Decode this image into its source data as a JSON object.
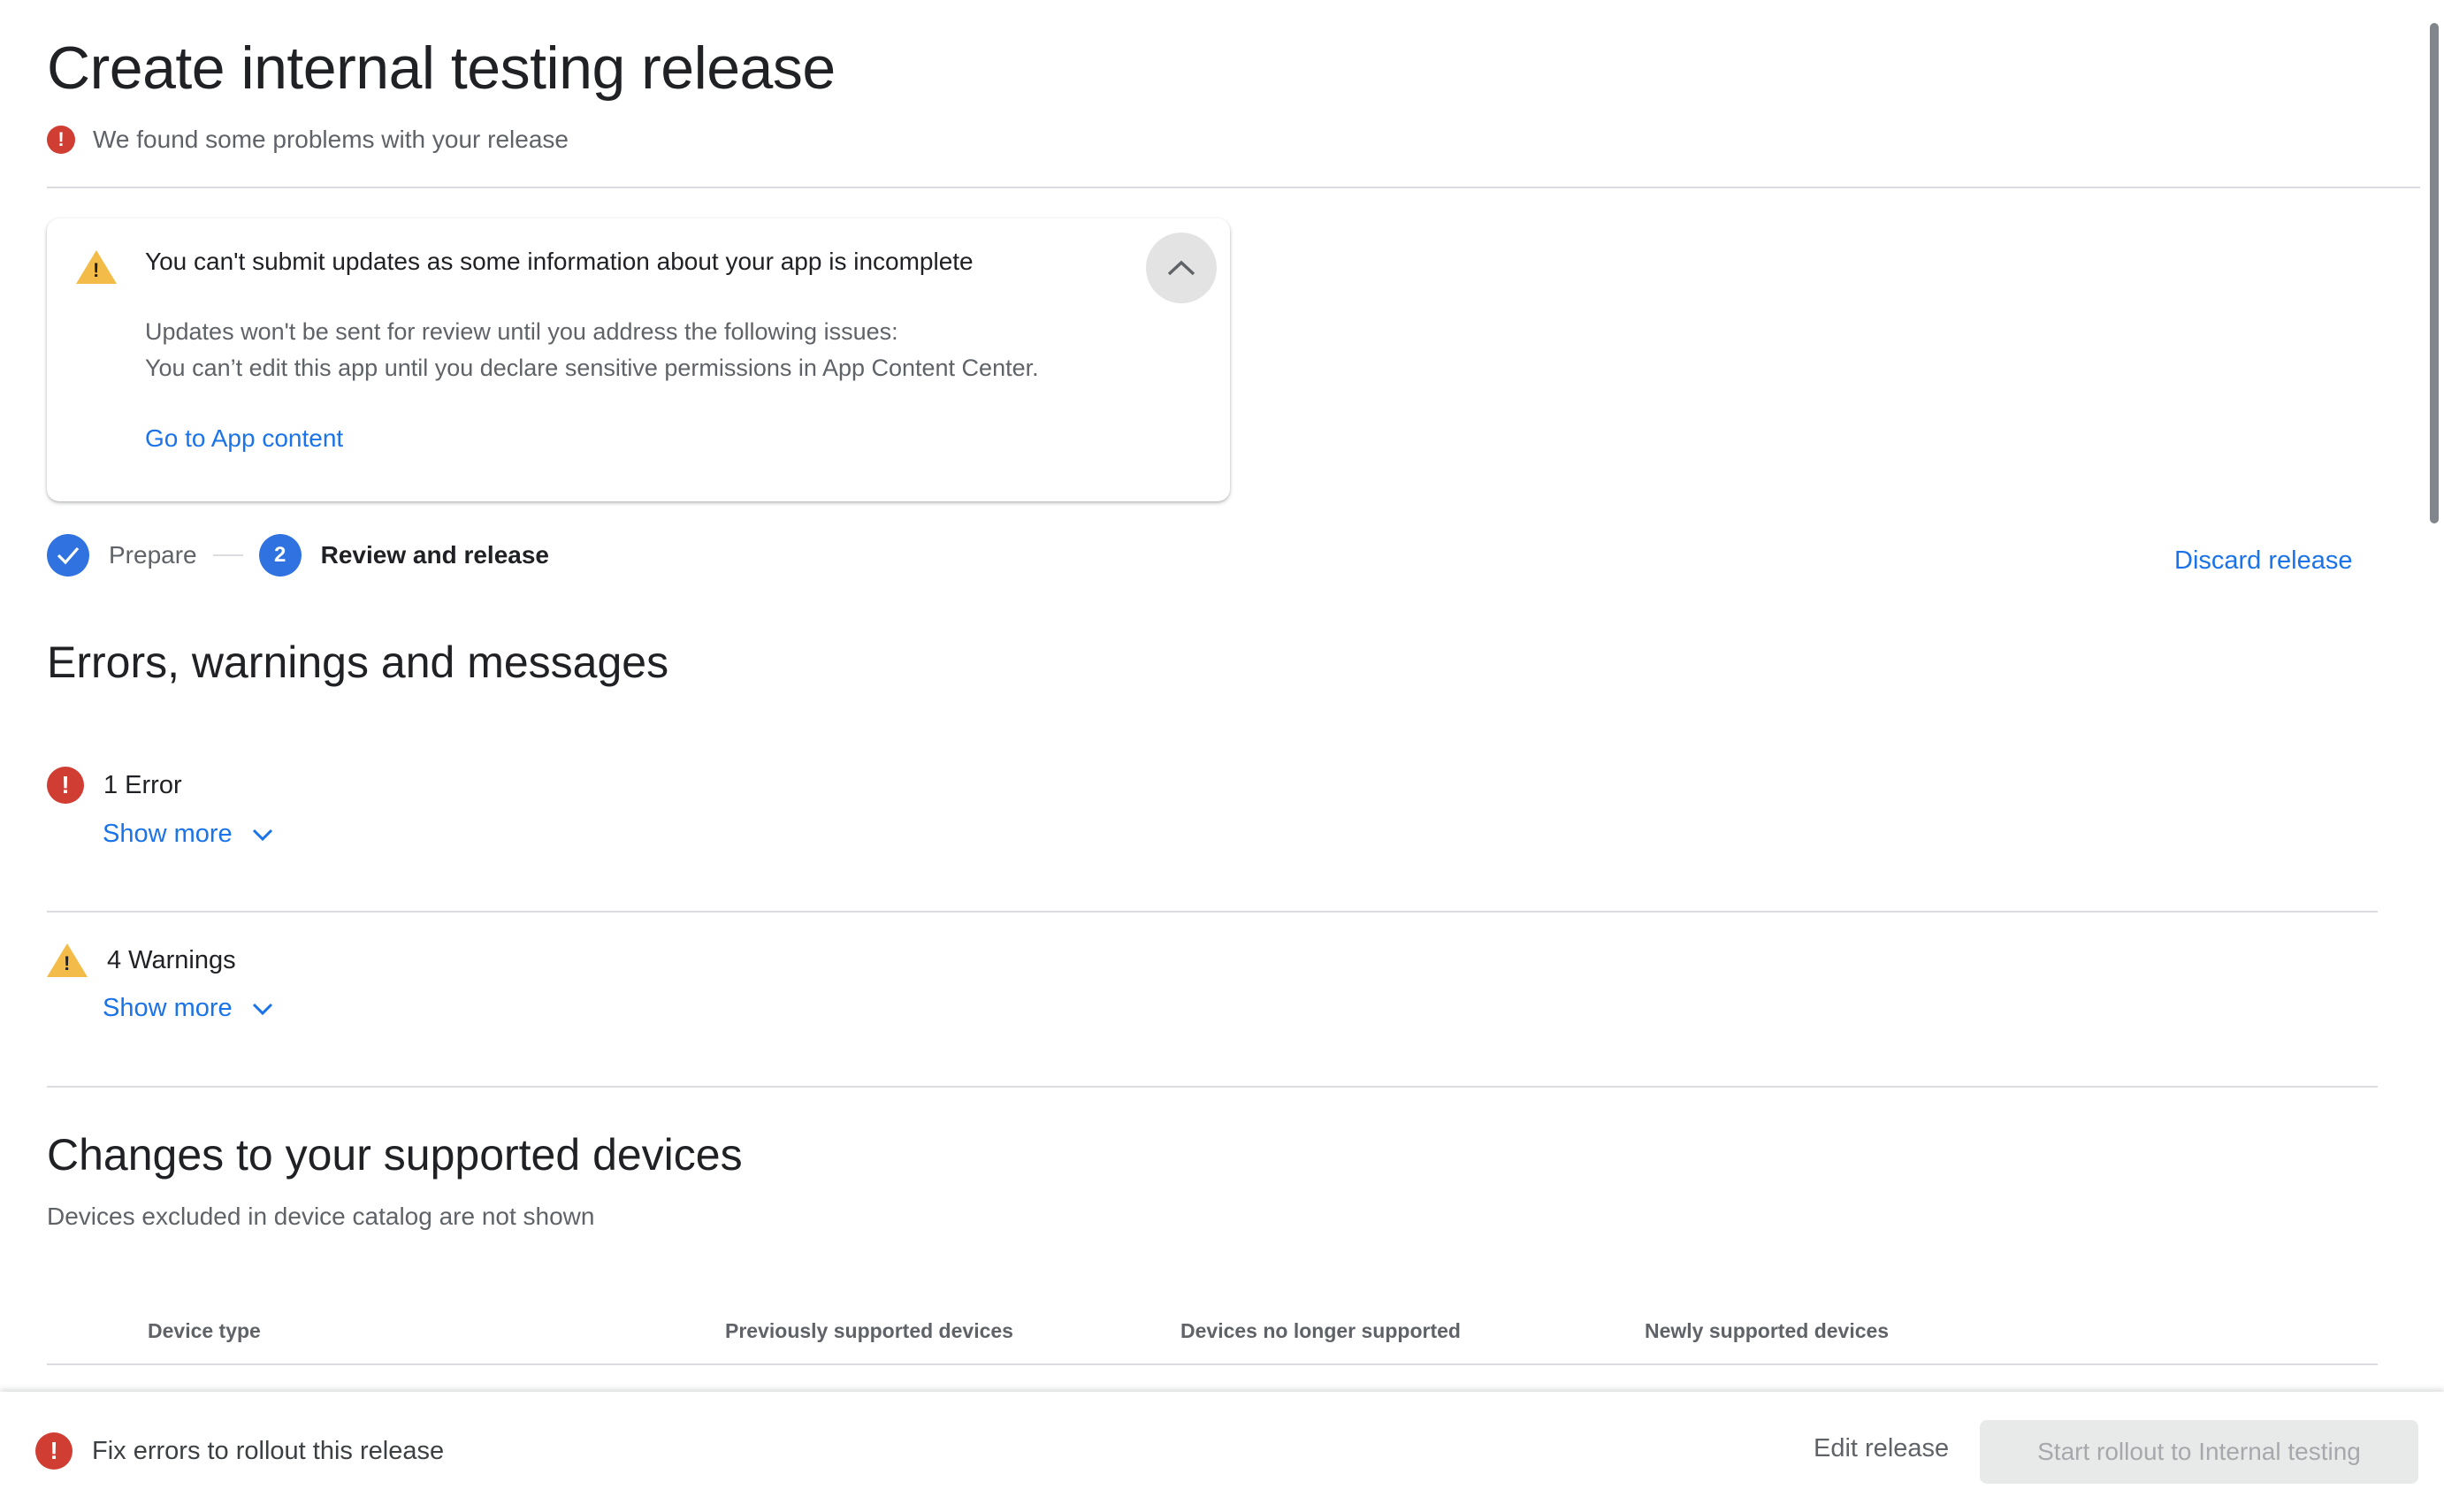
{
  "page": {
    "title": "Create internal testing release",
    "status_message": "We found some problems with your release"
  },
  "alert_card": {
    "title": "You can't submit updates as some information about your app is incomplete",
    "body_lines": [
      "Updates won't be sent for review until you address the following issues:",
      "You can’t edit this app until you declare sensitive permissions in App Content Center."
    ],
    "link_label": "Go to App content",
    "collapse_icon": "chevron-up-icon"
  },
  "stepper": {
    "steps": [
      {
        "label": "Prepare",
        "state": "completed",
        "marker": "✓"
      },
      {
        "label": "Review and release",
        "state": "active",
        "marker": "2"
      }
    ]
  },
  "discard_label": "Discard release",
  "issues_section": {
    "heading": "Errors, warnings and messages",
    "groups": [
      {
        "label": "1 Error",
        "type": "error",
        "action": "Show more"
      },
      {
        "label": "4 Warnings",
        "type": "warning",
        "action": "Show more"
      }
    ]
  },
  "devices_section": {
    "heading": "Changes to your supported devices",
    "subtitle": "Devices excluded in device catalog are not shown",
    "columns": [
      "Device type",
      "Previously supported devices",
      "Devices no longer supported",
      "Newly supported devices"
    ]
  },
  "bottom_bar": {
    "message": "Fix errors to rollout this release",
    "edit_label": "Edit release",
    "rollout_label": "Start rollout to Internal testing"
  },
  "colors": {
    "accent": "#1a73e8",
    "error": "#d03d33",
    "warning": "#f3bb47",
    "step": "#2f72e0"
  }
}
